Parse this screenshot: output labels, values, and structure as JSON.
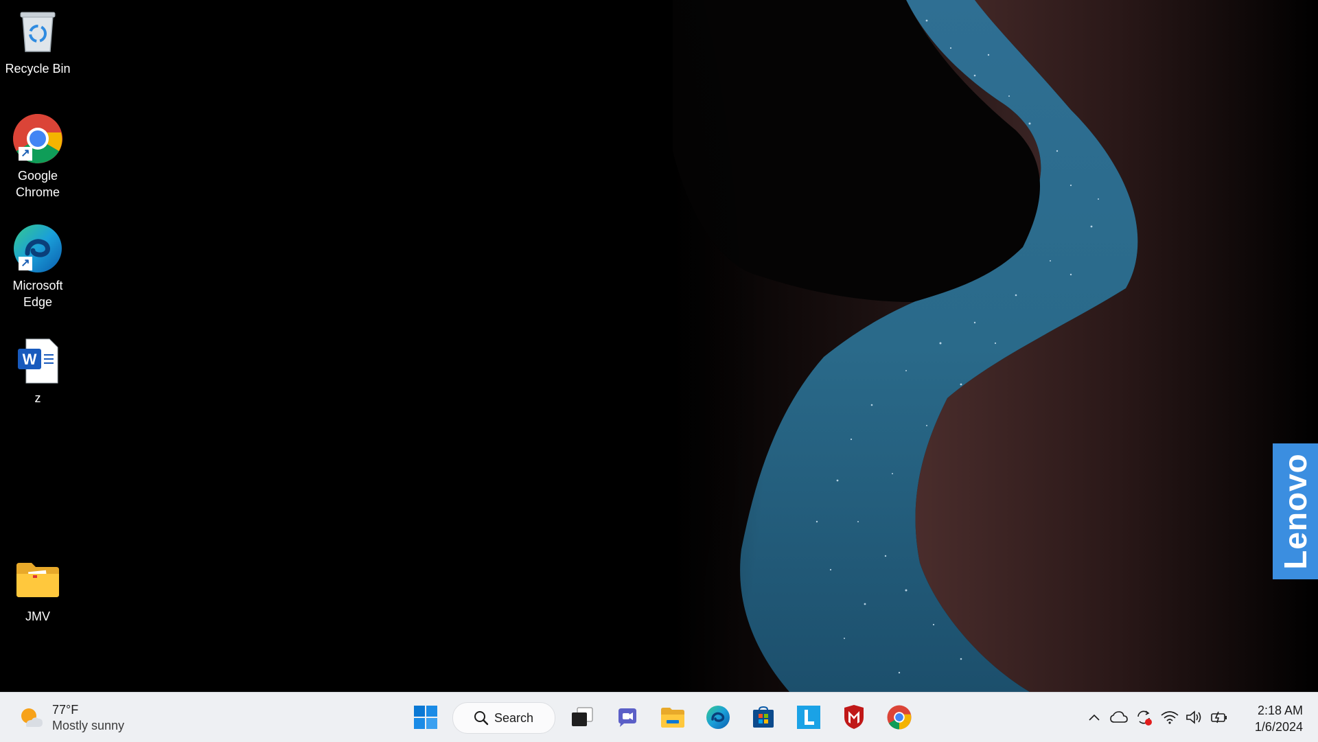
{
  "desktop": {
    "icons": [
      {
        "label": "Recycle Bin"
      },
      {
        "label": "Google Chrome"
      },
      {
        "label": "Microsoft Edge"
      },
      {
        "label": "z"
      },
      {
        "label": "JMV"
      }
    ]
  },
  "branding": {
    "lenovo_text": "Lenovo",
    "color": "#3b8ee0"
  },
  "taskbar": {
    "weather": {
      "temp": "77°F",
      "condition": "Mostly sunny",
      "icon": "partly-sunny-icon"
    },
    "search_label": "Search",
    "pinned": [
      {
        "name": "start-icon"
      },
      {
        "name": "task-view-icon"
      },
      {
        "name": "teams-chat-icon"
      },
      {
        "name": "file-explorer-icon"
      },
      {
        "name": "edge-icon"
      },
      {
        "name": "microsoft-store-icon"
      },
      {
        "name": "lenovo-vantage-icon"
      },
      {
        "name": "mcafee-icon"
      },
      {
        "name": "chrome-icon"
      }
    ],
    "tray": {
      "icons": [
        "chevron-up-icon",
        "onedrive-cloud-icon",
        "sync-alert-icon",
        "wifi-icon",
        "volume-icon",
        "battery-charging-icon"
      ],
      "time": "2:18 AM",
      "date": "1/6/2024"
    }
  }
}
